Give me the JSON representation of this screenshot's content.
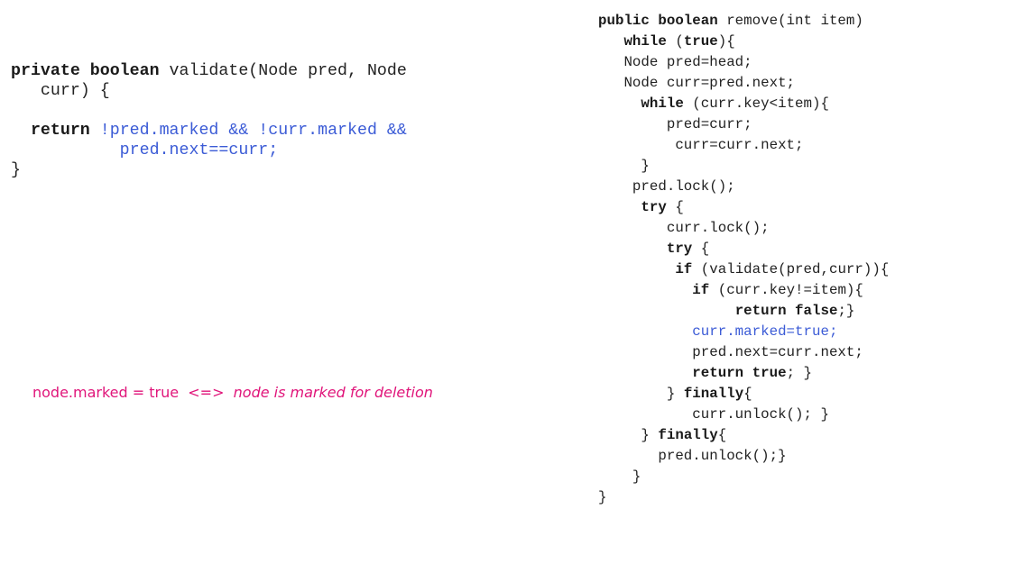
{
  "validate_code": {
    "l1_kw": "private boolean",
    "l1_rest": " validate(Node pred, Node",
    "l2": "   curr) {",
    "l3_indent": "  ",
    "l3_kw": "return",
    "l3_expr": " !pred.marked && !curr.marked &&",
    "l4_expr": "           pred.next==curr;",
    "l5": "}"
  },
  "remove_code": {
    "l1_kw": "public boolean",
    "l1_rest": " remove(int item)",
    "l2_kw": "while",
    "l2_paren": " (",
    "l2_true": "true",
    "l2_end": "){",
    "l3": "   Node pred=head;",
    "l4": "   Node curr=pred.next;",
    "l5_kw": "while",
    "l5_rest": " (curr.key<item){",
    "l6": "        pred=curr;",
    "l7": "         curr=curr.next;",
    "l8": "     }",
    "l9": "    pred.lock();",
    "l10_kw": "try",
    "l10_rest": " {",
    "l11": "        curr.lock();",
    "l12_kw": "try",
    "l12_rest": " {",
    "l13_kw": "if",
    "l13_rest": " (validate(pred,curr)){",
    "l14_kw": "if",
    "l14_rest": " (curr.key!=item){",
    "l15_kw": "return false",
    "l15_rest": ";}",
    "l16": "curr.marked=true;",
    "l17": "pred.next=curr.next;",
    "l18_kw": "return true",
    "l18_rest": "; }",
    "l19_brace": "} ",
    "l19_kw": "finally",
    "l19_rest": "{",
    "l20": "curr.unlock(); }",
    "l21_brace": "} ",
    "l21_kw": "finally",
    "l21_rest": "{",
    "l22": "pred.unlock();}",
    "l23": "}",
    "l24": "}"
  },
  "note": {
    "definition": "node.marked = true  <=>  ",
    "description": "node is marked for deletion"
  },
  "colors": {
    "keyword": "#1a1a1a",
    "highlight": "#3b5bd6",
    "note": "#e0157a"
  }
}
